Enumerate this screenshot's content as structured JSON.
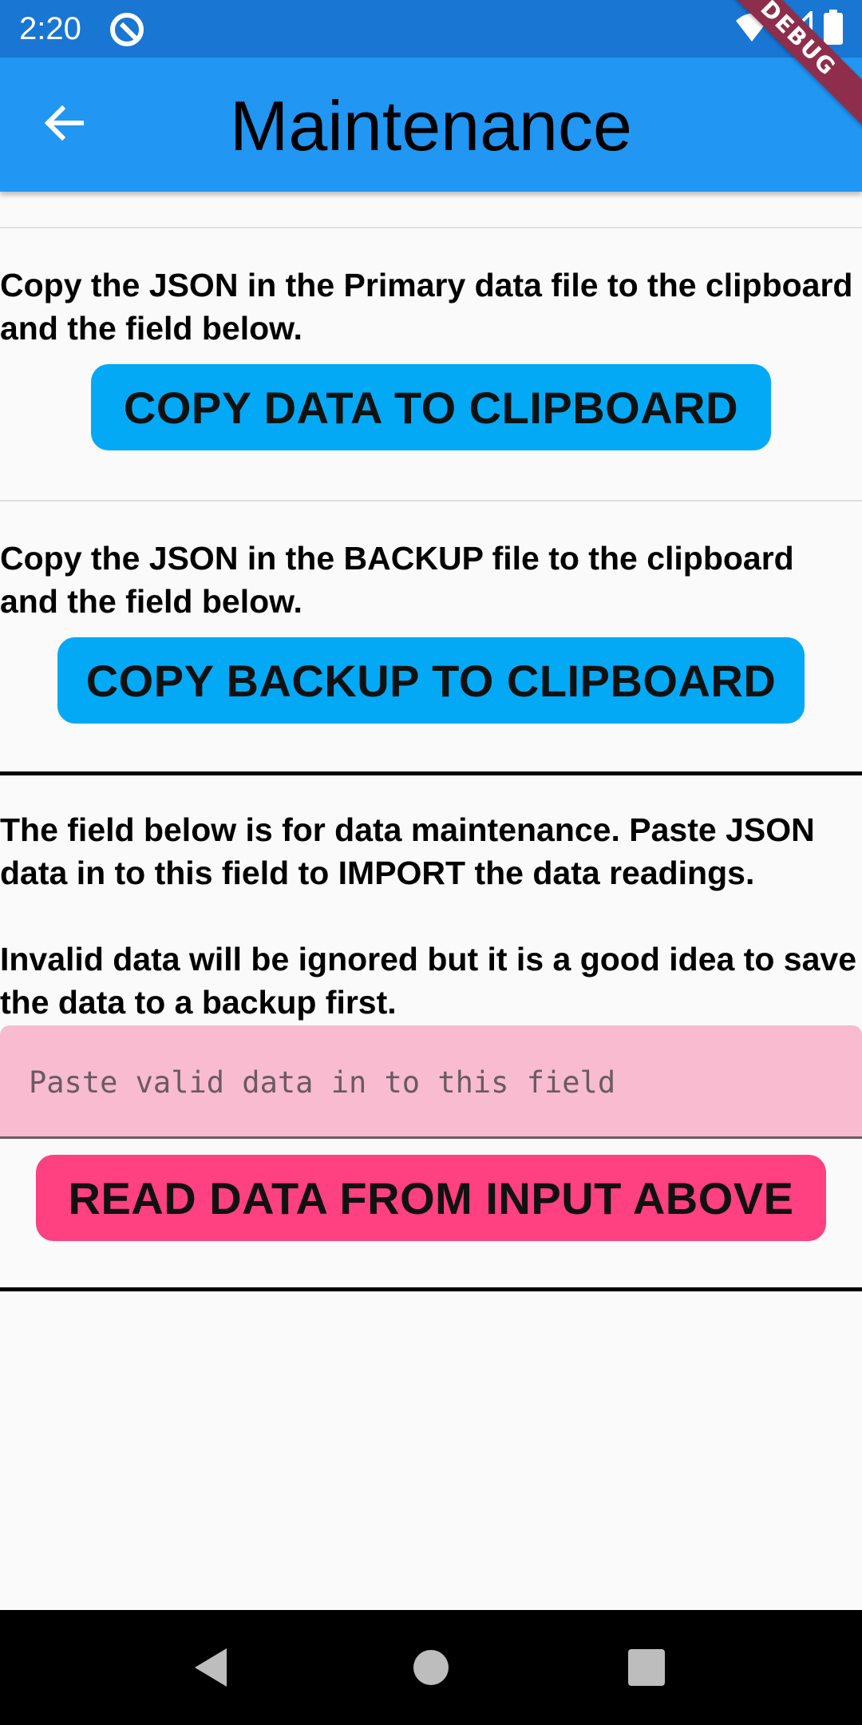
{
  "status_bar": {
    "time": "2:20",
    "debug_label": "DEBUG",
    "bg_color": "#1976d2"
  },
  "app_bar": {
    "title": "Maintenance",
    "bg_color": "#2196f3",
    "back_icon": "arrow-back-icon"
  },
  "sections": {
    "primary": {
      "text": "Copy the JSON in the Primary data file to the clipboard and the field below.",
      "button_label": "COPY DATA TO CLIPBOARD"
    },
    "backup": {
      "text": "Copy the JSON in the BACKUP file to the clipboard and the field below.",
      "button_label": "COPY BACKUP TO CLIPBOARD"
    },
    "maintenance": {
      "text": "The field below is for data maintenance. Paste JSON data in to this field to IMPORT the data readings.",
      "warning": "Invalid data will be ignored but it is a good idea to save the data to a backup first.",
      "input_placeholder": "Paste valid data in to this field",
      "input_value": "",
      "button_label": "READ DATA FROM INPUT ABOVE"
    }
  },
  "colors": {
    "button_blue": "#03a9f4",
    "button_pink": "#ff4081",
    "input_bg": "#f8bbd0"
  },
  "nav_bar": {
    "back_icon": "triangle-back-icon",
    "home_icon": "circle-home-icon",
    "recents_icon": "square-recents-icon"
  }
}
